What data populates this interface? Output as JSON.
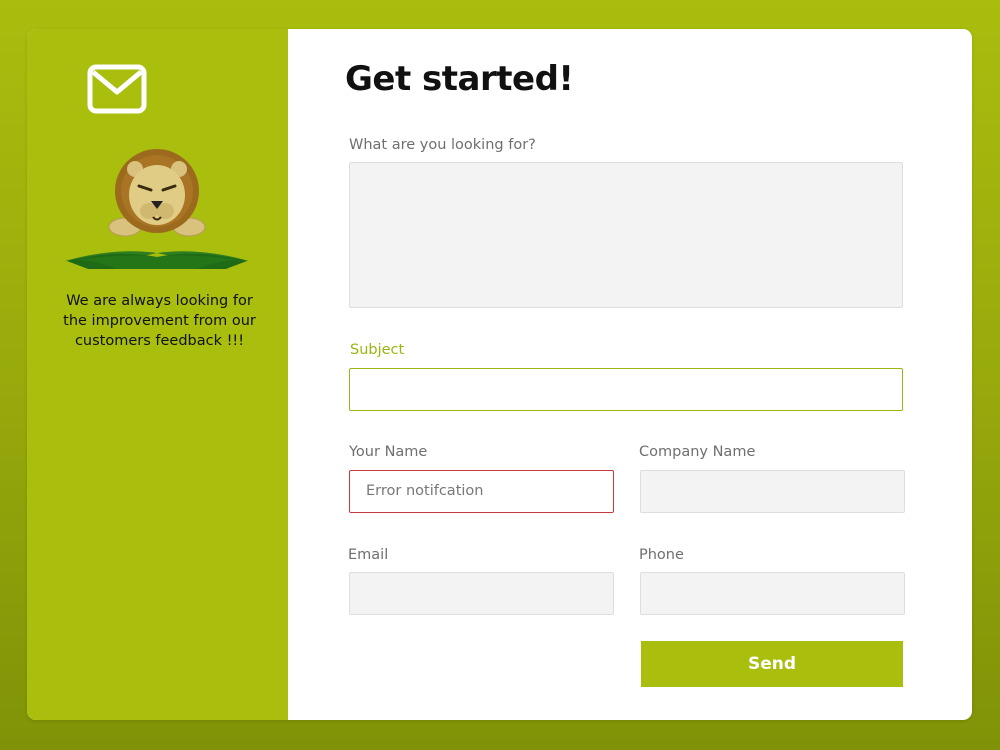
{
  "sidebar": {
    "icon": "mail-icon",
    "mascot": "lion-mascot-logo",
    "text": "We are always looking for the improvement from our customers feedback !!!"
  },
  "form": {
    "title": "Get started!",
    "looking_for": {
      "label": "What are you looking for?",
      "value": ""
    },
    "subject": {
      "label": "Subject",
      "value": ""
    },
    "your_name": {
      "label": "Your Name",
      "value": "Error notifcation"
    },
    "company_name": {
      "label": "Company Name",
      "value": ""
    },
    "email": {
      "label": "Email",
      "value": ""
    },
    "phone": {
      "label": "Phone",
      "value": ""
    },
    "send_label": "Send"
  },
  "colors": {
    "brand": "#aabe0e",
    "active_accent": "#9db512",
    "error": "#c7393e",
    "field_bg": "#f3f3f3"
  }
}
